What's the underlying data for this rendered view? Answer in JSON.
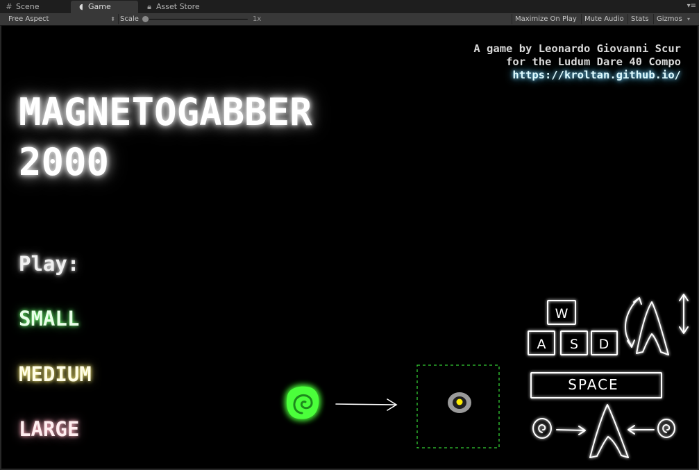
{
  "editor": {
    "tabs": [
      {
        "label": "Scene",
        "icon": "scene-grid-icon"
      },
      {
        "label": "Game",
        "icon": "game-pacman-icon",
        "active": true
      },
      {
        "label": "Asset Store",
        "icon": "asset-store-lock-icon"
      }
    ],
    "toolbar": {
      "aspect": "Free Aspect",
      "scale_label": "Scale",
      "scale_value": "1x",
      "buttons": [
        "Maximize On Play",
        "Mute Audio",
        "Stats",
        "Gizmos"
      ]
    }
  },
  "game": {
    "credits": {
      "line1": "A game by Leonardo Giovanni Scur",
      "line2": "for the Ludum Dare 40 Compo",
      "link": "https://kroltan.github.io/"
    },
    "title_line1": "MAGNETOGABBER",
    "title_line2": "2000",
    "play_label": "Play:",
    "options": [
      "SMALL",
      "MEDIUM",
      "LARGE"
    ],
    "controls": {
      "keys": [
        "W",
        "A",
        "S",
        "D"
      ],
      "space": "SPACE",
      "magnet_glyph": "A"
    },
    "colors": {
      "small": "#6dff6d",
      "medium": "#fff27a",
      "large": "#ffb0c0",
      "link": "#7ed7ff",
      "blob": "#4cff3a",
      "dot": "#ffee00"
    }
  }
}
